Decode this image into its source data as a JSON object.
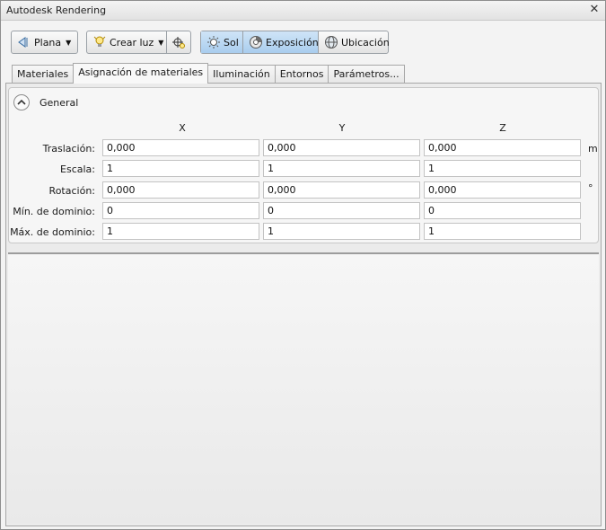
{
  "window": {
    "title": "Autodesk Rendering",
    "close_glyph": "✕"
  },
  "toolbar": {
    "plana_label": "Plana",
    "crear_luz_label": "Crear luz",
    "sol_label": "Sol",
    "exposicion_label": "Exposición",
    "ubicacion_label": "Ubicación",
    "caret": "▼"
  },
  "tabs": [
    {
      "label": "Materiales"
    },
    {
      "label": "Asignación de materiales"
    },
    {
      "label": "Iluminación"
    },
    {
      "label": "Entornos"
    },
    {
      "label": "Parámetros..."
    }
  ],
  "selected_tab": "Asignación de materiales",
  "general": {
    "title": "General",
    "columns": [
      "X",
      "Y",
      "Z"
    ],
    "rows": [
      {
        "label": "Traslación:",
        "values": [
          "0,000",
          "0,000",
          "0,000"
        ],
        "unit": "m"
      },
      {
        "label": "Escala:",
        "values": [
          "1",
          "1",
          "1"
        ],
        "unit": ""
      },
      {
        "label": "Rotación:",
        "values": [
          "0,000",
          "0,000",
          "0,000"
        ],
        "unit": "°"
      },
      {
        "label": "Mín. de dominio:",
        "values": [
          "0",
          "0",
          "0"
        ],
        "unit": ""
      },
      {
        "label": "Máx. de dominio:",
        "values": [
          "1",
          "1",
          "1"
        ],
        "unit": ""
      }
    ]
  },
  "colors": {
    "active_button": "#a9cdee",
    "panel_bg": "#ebebeb"
  }
}
